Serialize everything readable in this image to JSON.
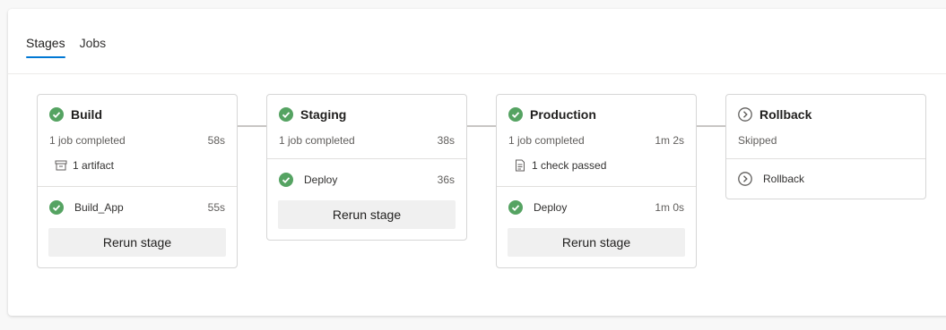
{
  "tabs": [
    {
      "label": "Stages",
      "active": true
    },
    {
      "label": "Jobs",
      "active": false
    }
  ],
  "colors": {
    "success": "#55a362",
    "accent": "#0078d4",
    "skipped": "#605e5c"
  },
  "stages": [
    {
      "name": "Build",
      "status": "succeeded",
      "summary": "1 job completed",
      "duration": "58s",
      "extra": "1 artifact",
      "extra_icon": "artifact-icon",
      "jobs": [
        {
          "name": "Build_App",
          "time": "55s",
          "status": "succeeded"
        }
      ],
      "rerun_label": "Rerun stage"
    },
    {
      "name": "Staging",
      "status": "succeeded",
      "summary": "1 job completed",
      "duration": "38s",
      "jobs": [
        {
          "name": "Deploy",
          "time": "36s",
          "status": "succeeded"
        }
      ],
      "rerun_label": "Rerun stage"
    },
    {
      "name": "Production",
      "status": "succeeded",
      "summary": "1 job completed",
      "duration": "1m 2s",
      "extra": "1 check passed",
      "extra_icon": "checklist-icon",
      "jobs": [
        {
          "name": "Deploy",
          "time": "1m 0s",
          "status": "succeeded"
        }
      ],
      "rerun_label": "Rerun stage"
    },
    {
      "name": "Rollback",
      "status": "skipped",
      "summary": "Skipped",
      "duration": "",
      "jobs": [
        {
          "name": "Rollback",
          "time": "",
          "status": "skipped"
        }
      ]
    }
  ]
}
